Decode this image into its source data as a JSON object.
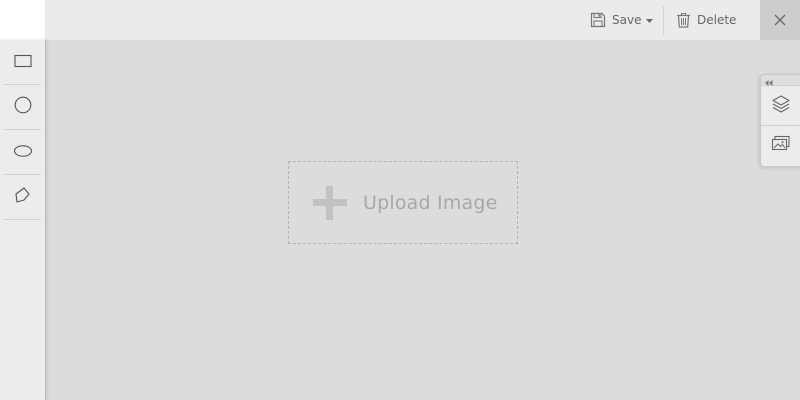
{
  "toolbar": {
    "save_label": "Save",
    "delete_label": "Delete"
  },
  "shape_tools": [
    {
      "name": "rectangle",
      "icon": "rectangle-icon"
    },
    {
      "name": "circle",
      "icon": "circle-icon"
    },
    {
      "name": "ellipse",
      "icon": "ellipse-icon"
    },
    {
      "name": "polygon",
      "icon": "polygon-icon"
    }
  ],
  "canvas": {
    "upload_label": "Upload Image"
  },
  "right_panel": {
    "items": [
      {
        "name": "layers",
        "icon": "layers-icon"
      },
      {
        "name": "images",
        "icon": "images-icon"
      }
    ]
  }
}
